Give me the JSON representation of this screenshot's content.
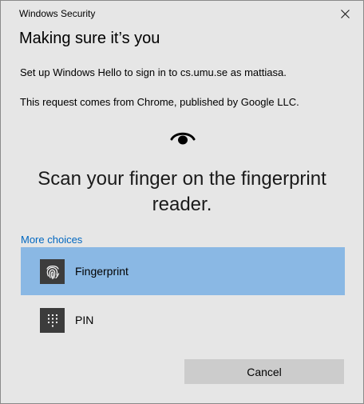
{
  "window": {
    "app_title": "Windows Security",
    "close_icon": "close-icon"
  },
  "dialog": {
    "heading": "Making sure it’s you",
    "message_setup": "Set up Windows Hello to sign in to cs.umu.se as mattiasa.",
    "message_request": "This request comes from Chrome, published by Google LLC.",
    "status_icon": "eye-icon",
    "instruction": "Scan your finger on the fingerprint reader.",
    "more_choices_label": "More choices"
  },
  "options": [
    {
      "label": "Fingerprint",
      "icon": "fingerprint-icon",
      "selected": true
    },
    {
      "label": "PIN",
      "icon": "pin-keypad-icon",
      "selected": false
    }
  ],
  "actions": {
    "cancel_label": "Cancel"
  },
  "colors": {
    "background": "#e6e6e6",
    "selected_option": "#8ab8e4",
    "link": "#0067c0",
    "button": "#cccccc",
    "icon_tile": "#3c3c3c"
  }
}
